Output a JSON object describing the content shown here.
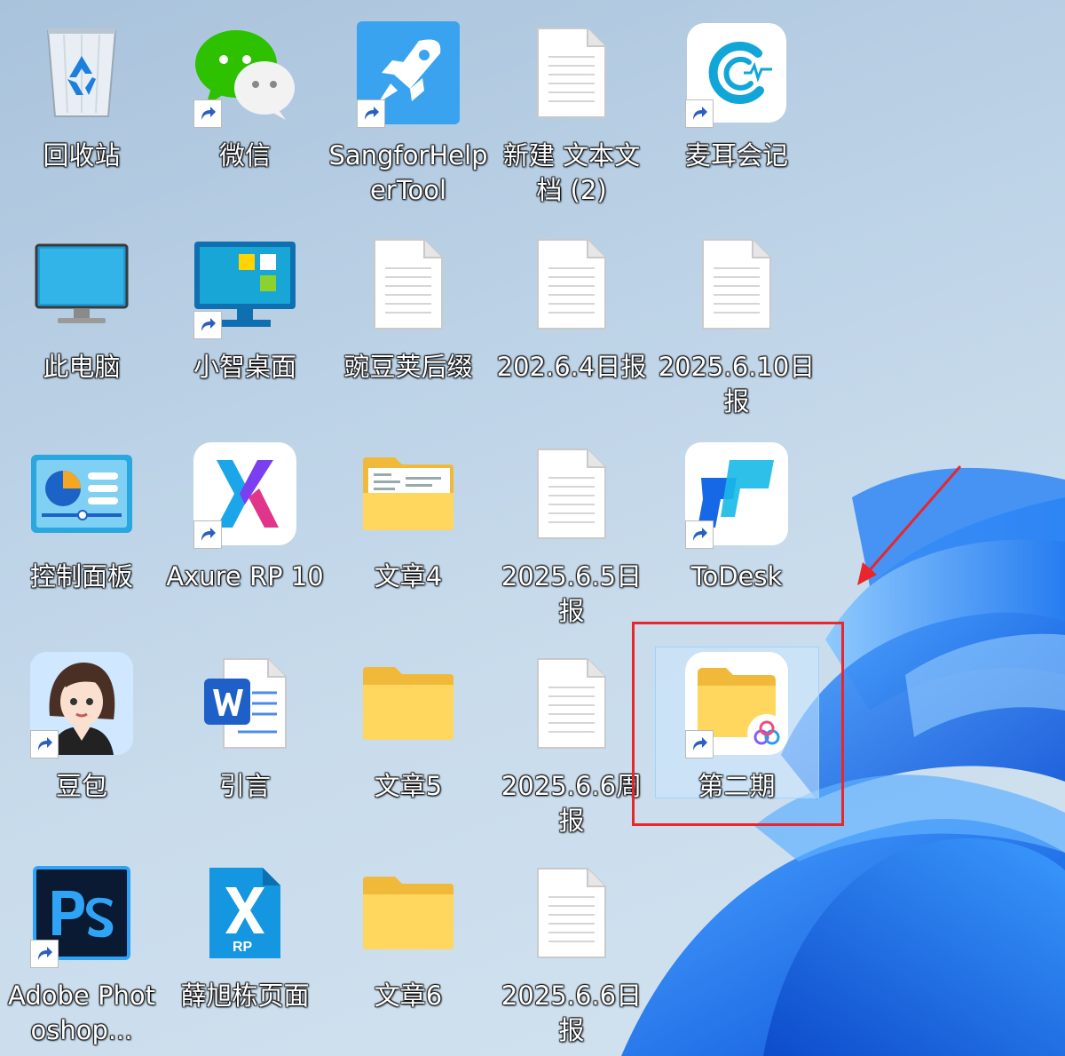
{
  "desktop": {
    "icons": [
      {
        "label": "回收站",
        "icon": "recycle-bin-icon"
      },
      {
        "label": "微信",
        "icon": "wechat-icon"
      },
      {
        "label": "SangforHelperTool",
        "icon": "sangfor-rocket-icon"
      },
      {
        "label": "新建 文本文档 (2)",
        "icon": "text-document-icon"
      },
      {
        "label": "麦耳会记",
        "icon": "maier-meeting-icon"
      },
      {
        "label": "此电脑",
        "icon": "this-pc-icon"
      },
      {
        "label": "小智桌面",
        "icon": "xiaozhi-desktop-icon"
      },
      {
        "label": "豌豆荚后缀",
        "icon": "text-document-icon"
      },
      {
        "label": "202.6.4日报",
        "icon": "text-document-icon"
      },
      {
        "label": "2025.6.10日报",
        "icon": "text-document-icon"
      },
      {
        "label": "控制面板",
        "icon": "control-panel-icon"
      },
      {
        "label": "Axure RP 10",
        "icon": "axure-icon"
      },
      {
        "label": "文章4",
        "icon": "folder-with-files-icon"
      },
      {
        "label": "2025.6.5日报",
        "icon": "text-document-icon"
      },
      {
        "label": "ToDesk",
        "icon": "todesk-icon"
      },
      {
        "label": "豆包",
        "icon": "doubao-avatar-icon"
      },
      {
        "label": "引言",
        "icon": "word-document-icon"
      },
      {
        "label": "文章5",
        "icon": "folder-icon"
      },
      {
        "label": "2025.6.6周报",
        "icon": "text-document-icon"
      },
      {
        "label": "第二期",
        "icon": "shared-folder-icon"
      },
      {
        "label": "Adobe Photoshop...",
        "icon": "photoshop-icon"
      },
      {
        "label": "薛旭栋页面",
        "icon": "axure-rp-file-icon"
      },
      {
        "label": "文章6",
        "icon": "folder-icon"
      },
      {
        "label": "2025.6.6日报",
        "icon": "text-document-icon"
      }
    ]
  },
  "colors": {
    "highlight_border": "#e8262b",
    "selection_fill": "#cce8ff",
    "wallpaper_blue": "#1a6fe8"
  }
}
